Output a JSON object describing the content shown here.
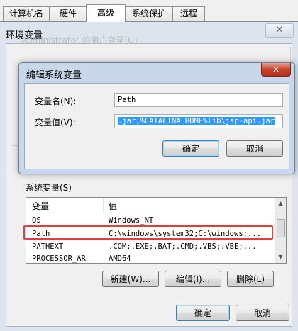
{
  "tabs": [
    "计算机名",
    "硬件",
    "高级",
    "系统保护",
    "远程"
  ],
  "env_window": {
    "title": "环境变量",
    "close_glyph": "✕",
    "user_vars_label": "Administrator 的用户变量(U)",
    "system_vars_label": "系统变量(S)",
    "columns": [
      "变量",
      "值"
    ],
    "rows": [
      {
        "name": "OS",
        "value": "Windows_NT"
      },
      {
        "name": "Path",
        "value": "C:\\windows\\system32;C:\\windows;..."
      },
      {
        "name": "PATHEXT",
        "value": ".COM;.EXE;.BAT;.CMD;.VBS;.VBE;..."
      },
      {
        "name": "PROCESSOR_AR",
        "value": "AMD64"
      }
    ],
    "buttons": {
      "new": "新建(W)...",
      "edit": "编辑(I)...",
      "delete": "删除(L)",
      "ok": "确定",
      "cancel": "取消"
    },
    "highlight_color": "#e0403c"
  },
  "edit_dialog": {
    "title": "编辑系统变量",
    "close_glyph": "✕",
    "name_label": "变量名(N):",
    "value_label": "变量值(V):",
    "name_value": "Path",
    "value_value": ".jar;%CATALINA_HOME%lib\\jsp-api.jar",
    "ok": "确定",
    "cancel": "取消"
  }
}
